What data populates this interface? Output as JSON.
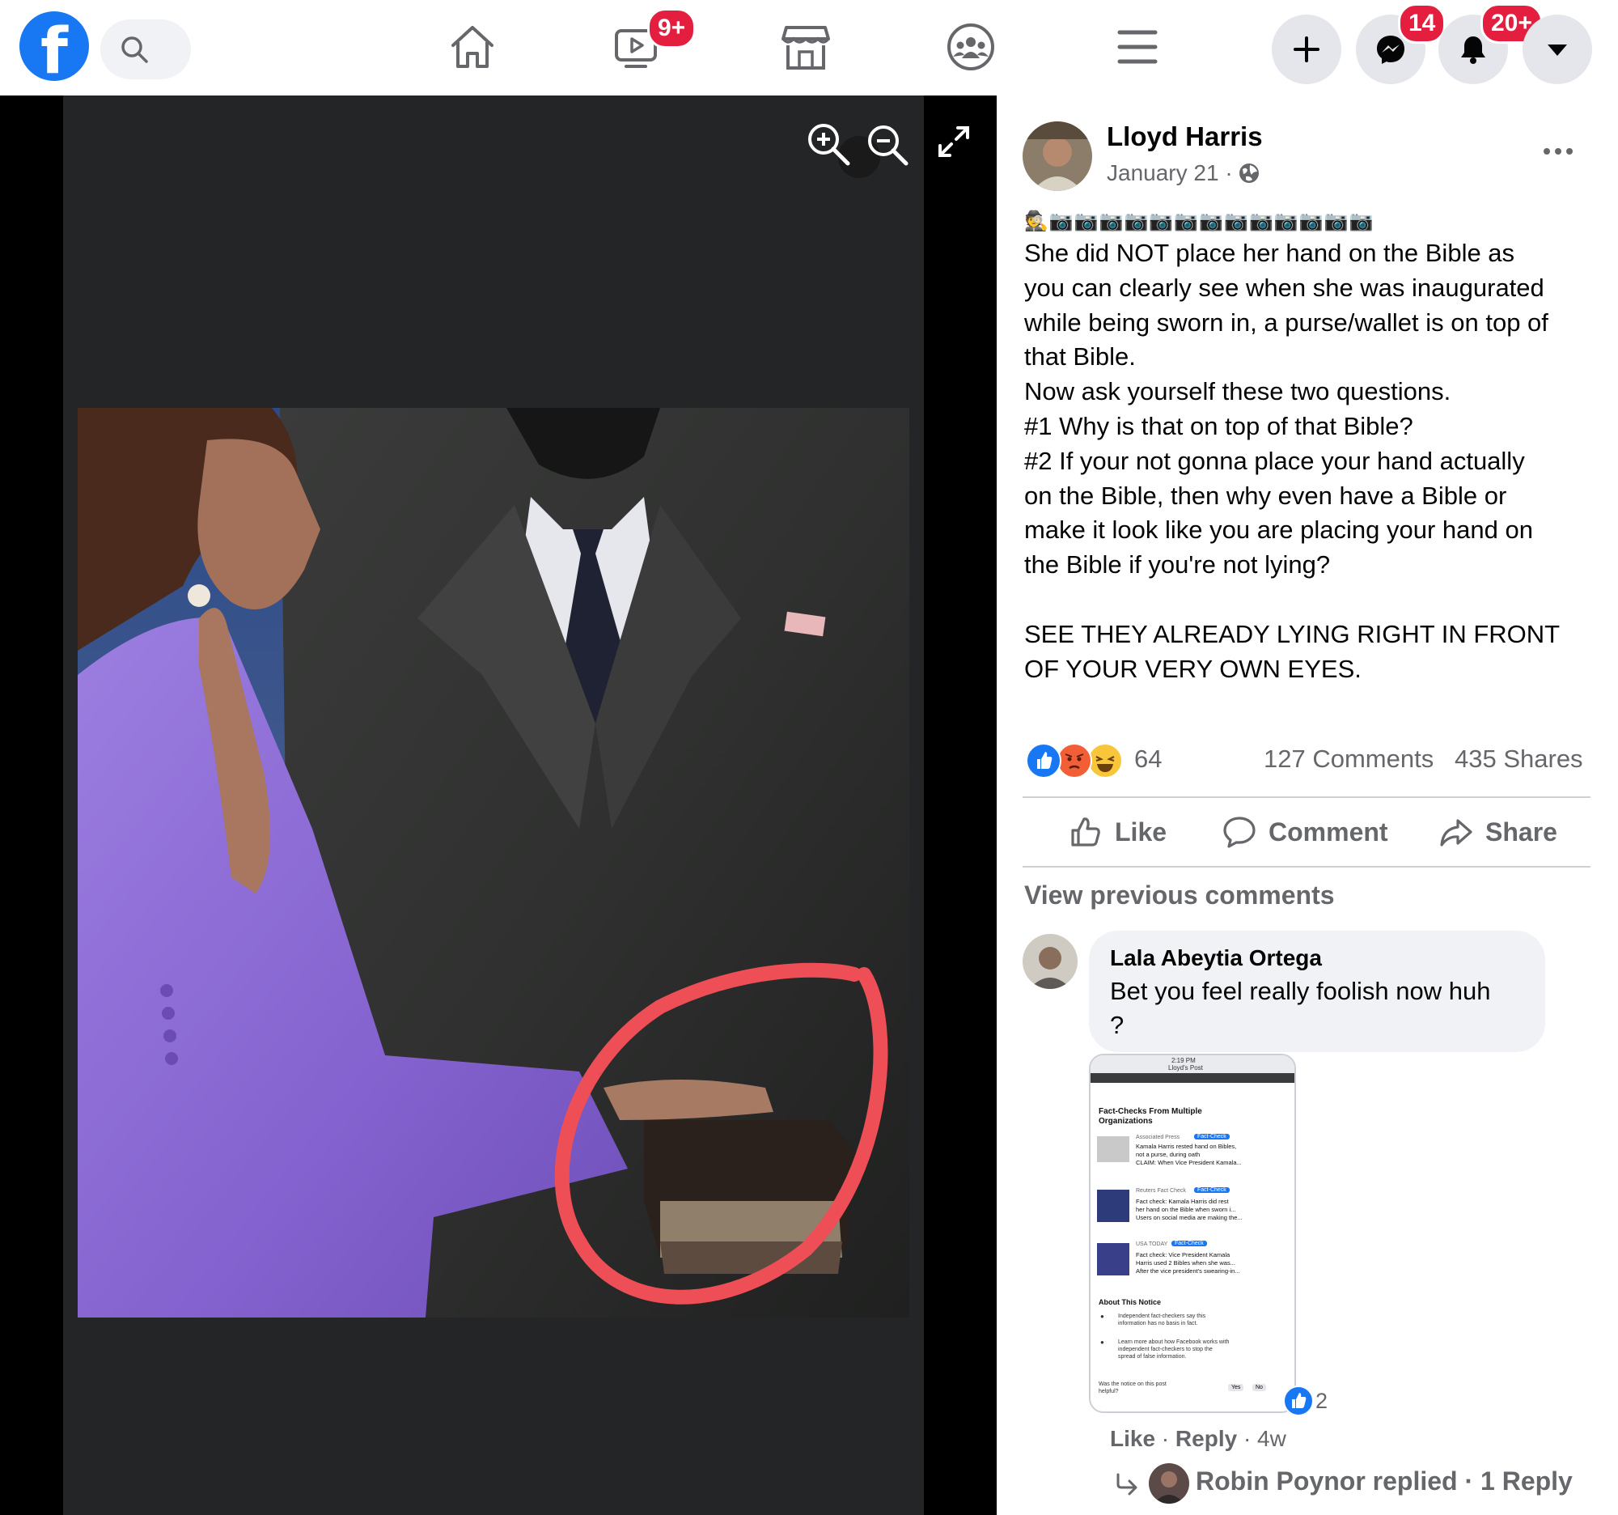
{
  "topbar": {
    "brand_letter": "f",
    "icons": [
      "facebook-logo",
      "search-icon",
      "home-icon",
      "watch-icon",
      "marketplace-icon",
      "groups-icon",
      "menu-icon",
      "create-icon",
      "messenger-icon",
      "notifications-icon",
      "account-menu-icon"
    ],
    "watch_badge": "9+",
    "messenger_badge": "14",
    "notifications_badge": "20+"
  },
  "post": {
    "author": "Lloyd Harris",
    "date": "January 21 ·",
    "privacy_icon": "globe-icon",
    "emoji_line": "🕵📷📷📷📷📷📷📷📷📷📷📷📷📷",
    "lines": [
      "She did NOT place her hand on the Bible as",
      "you can clearly see when she was inaugurated",
      "while being sworn in, a purse/wallet is on top of",
      "that Bible.",
      "Now ask yourself these two questions.",
      "#1 Why is that on top of that Bible?",
      "#2 If your not gonna place your hand actually",
      "on the Bible, then why even have a Bible or",
      "make it look like you are placing your hand on",
      "the Bible if you're not lying?",
      "",
      "SEE THEY ALREADY LYING RIGHT IN FRONT",
      "OF YOUR VERY OWN EYES."
    ],
    "reaction_count": "64",
    "comments_count": "127 Comments",
    "shares_count": "435 Shares",
    "actions": {
      "like": "Like",
      "comment": "Comment",
      "share": "Share"
    },
    "view_previous": "View previous comments"
  },
  "comment": {
    "author": "Lala Abeytia Ortega",
    "line1": "Bet you feel really foolish now huh",
    "line2": "?",
    "like_count": "2",
    "like": "Like",
    "sep1": " · ",
    "reply": "Reply",
    "time": " · 4w",
    "replies_text": "Robin Poynor replied · 1 Reply"
  },
  "attachment": {
    "status_time": "2:19 PM",
    "header": "Lloyd's Post",
    "title": "Fact-Checks From Multiple Organizations",
    "items": [
      {
        "source": "Associated Press",
        "tag": "Fact-Check",
        "line1": "Kamala Harris rested hand on Bibles,",
        "line2": "not a purse, during oath",
        "line3": "CLAIM: When Vice President Kamala..."
      },
      {
        "source": "Reuters Fact Check",
        "tag": "Fact-Check",
        "line1": "Fact check: Kamala Harris did rest",
        "line2": "her hand on the Bible when sworn i...",
        "line3": "Users on social media are making the..."
      },
      {
        "source": "USA TODAY",
        "tag": "Fact-Check",
        "line1": "Fact check: Vice President Kamala",
        "line2": "Harris used 2 Bibles when she was...",
        "line3": "After the vice president's swearing-in..."
      }
    ],
    "notice_title": "About This Notice",
    "notice_1a": "Independent fact-checkers say this",
    "notice_1b": "information has no basis in fact.",
    "notice_2a": "Learn more about how Facebook works with",
    "notice_2b": "independent fact-checkers to stop the",
    "notice_2c": "spread of false information.",
    "helpful_q": "Was the notice on this post",
    "helpful_q2": "helpful?",
    "yes": "Yes",
    "no": "No"
  },
  "colors": {
    "brand": "#1877f2",
    "badge": "#e41e3f",
    "suit": "#8a63d2",
    "annotation_circle": "#ee4e56"
  }
}
